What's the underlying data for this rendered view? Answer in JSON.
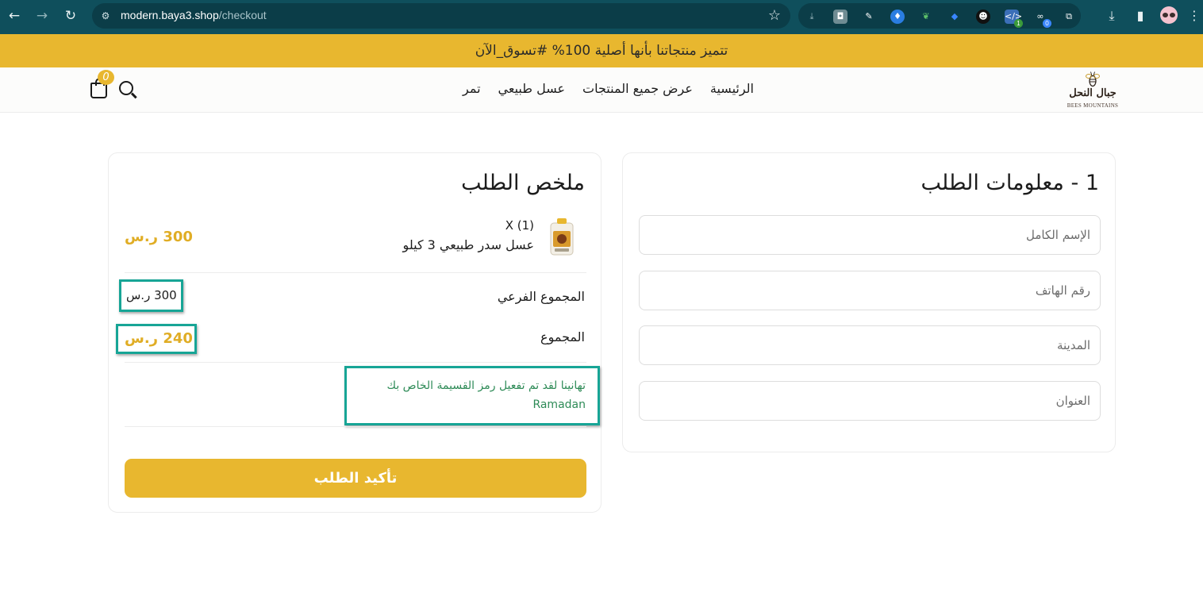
{
  "browser": {
    "url_host": "modern.baya3.shop",
    "url_path": "/checkout",
    "ext_badges": [
      "1",
      "0"
    ]
  },
  "announcement": "تتميز منتجاتنا بأنها أصلية 100% #تسوق_الآن",
  "header": {
    "cart_count": "0",
    "nav": [
      "الرئيسية",
      "عرض جميع المنتجات",
      "عسل طبيعي",
      "تمر"
    ],
    "logo_ar": "جبال النحل",
    "logo_en": "BEES MOUNTAINS"
  },
  "order_info": {
    "title": "1 - معلومات الطلب",
    "fields": [
      {
        "placeholder": "الإسم الكامل",
        "value": ""
      },
      {
        "placeholder": "رقم الهاتف",
        "value": ""
      },
      {
        "placeholder": "المدينة",
        "value": ""
      },
      {
        "placeholder": "العنوان",
        "value": ""
      }
    ]
  },
  "summary": {
    "title": "ملخص الطلب",
    "item": {
      "qty": "X (1)",
      "name": "عسل سدر طبيعي 3 كيلو",
      "price": "300 ر.س"
    },
    "subtotal_label": "المجموع الفرعي",
    "subtotal_value": "300 ر.س",
    "total_label": "المجموع",
    "total_value": "240 ر.س",
    "coupon_message": "تهانينا لقد تم تفعيل رمز القسيمة الخاص بك",
    "coupon_code": "Ramadan",
    "confirm_label": "تأكيد الطلب"
  },
  "colors": {
    "chrome": "#0f4f5c",
    "accent": "#e8b72f",
    "price": "#e0ad25",
    "highlight": "#17a596",
    "success": "#2e8b57"
  }
}
